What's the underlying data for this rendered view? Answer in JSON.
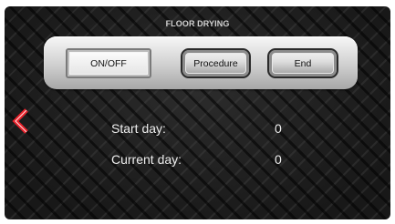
{
  "header": {
    "title": "FLOOR DRYING"
  },
  "buttons": {
    "onoff_label": "ON/OFF",
    "procedure_label": "Procedure",
    "end_label": "End"
  },
  "info": {
    "start_day_label": "Start day:",
    "start_day_value": "0",
    "current_day_label": "Current day:",
    "current_day_value": "0"
  },
  "icons": {
    "back": "chevron-left-icon"
  },
  "colors": {
    "back_arrow": "#e8202a",
    "text": "#eeeeee",
    "title": "#d2d2d2"
  }
}
